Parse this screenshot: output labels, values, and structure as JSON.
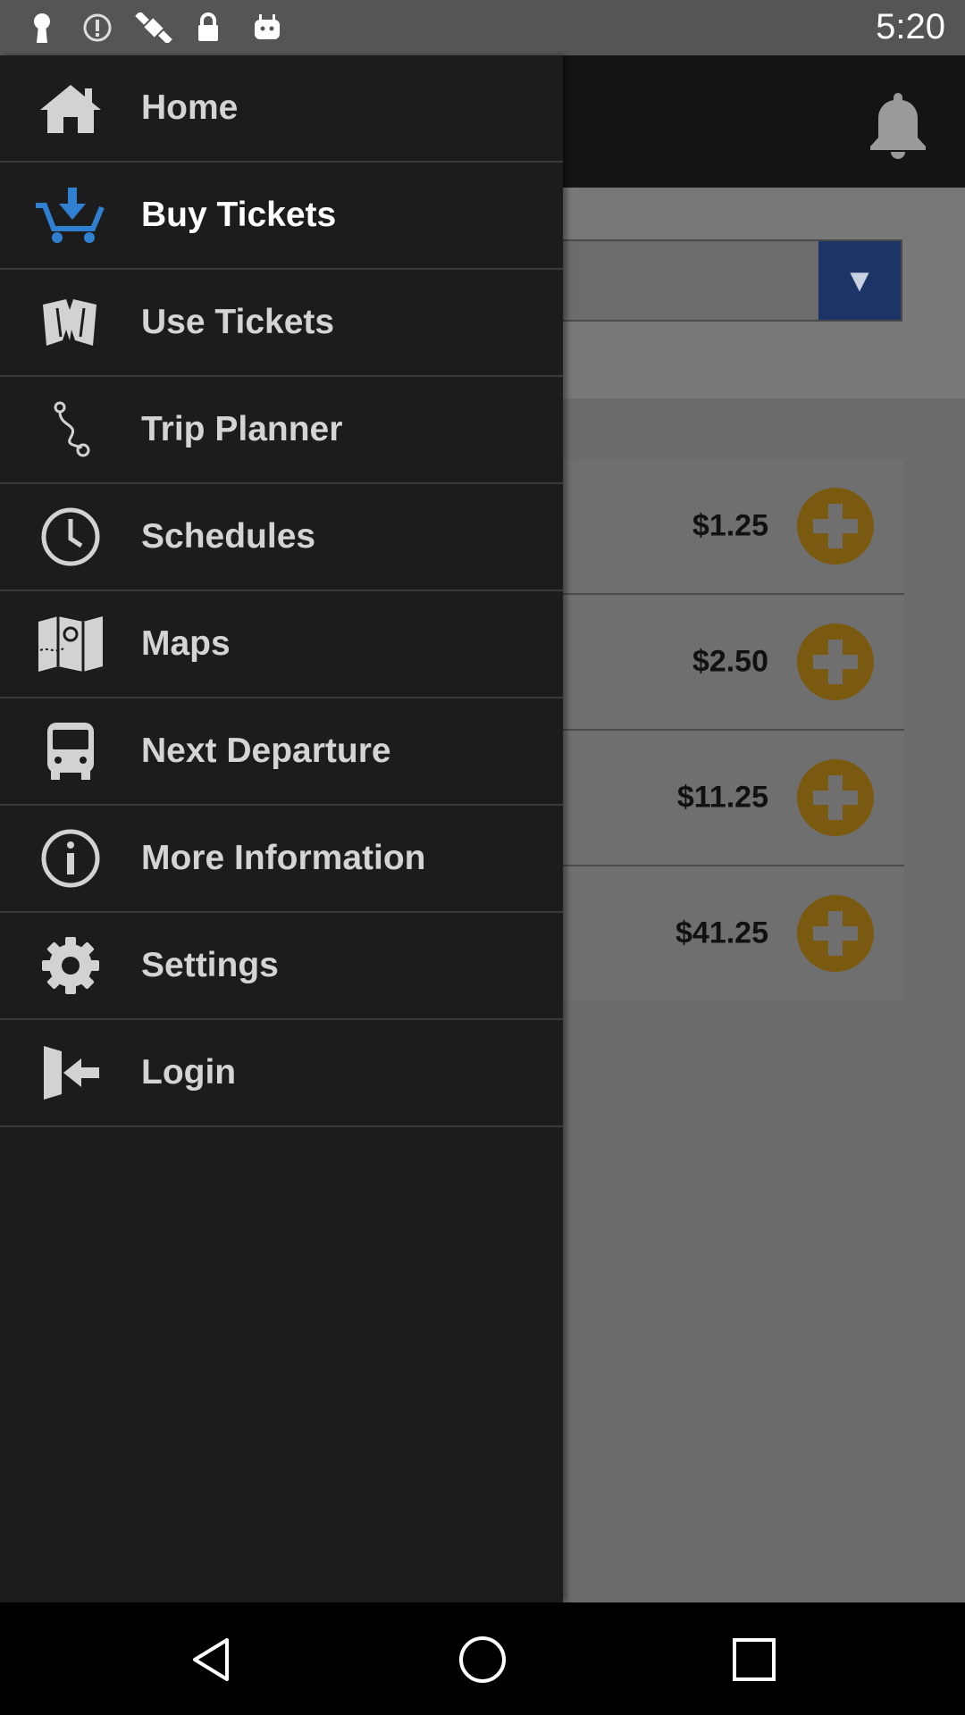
{
  "status_bar": {
    "time": "5:20",
    "icons": [
      "keyhole-icon",
      "alert-circle-icon",
      "satellite-fake-gps-icon",
      "lock-icon",
      "android-icon"
    ]
  },
  "app": {
    "tickets": [
      {
        "price": "$1.25"
      },
      {
        "price": "$2.50"
      },
      {
        "price": "$11.25"
      },
      {
        "price": "$41.25"
      }
    ],
    "colors": {
      "accent": "#1c3566",
      "add_button": "#7a5a10",
      "active_icon": "#2f80d0"
    }
  },
  "drawer": {
    "items": [
      {
        "label": "Home",
        "icon": "home-icon"
      },
      {
        "label": "Buy Tickets",
        "icon": "cart-download-icon"
      },
      {
        "label": "Use Tickets",
        "icon": "tickets-icon"
      },
      {
        "label": "Trip Planner",
        "icon": "route-icon"
      },
      {
        "label": "Schedules",
        "icon": "clock-icon"
      },
      {
        "label": "Maps",
        "icon": "map-icon"
      },
      {
        "label": "Next Departure",
        "icon": "bus-icon"
      },
      {
        "label": "More Information",
        "icon": "info-icon"
      },
      {
        "label": "Settings",
        "icon": "gear-icon"
      },
      {
        "label": "Login",
        "icon": "login-icon"
      }
    ]
  }
}
